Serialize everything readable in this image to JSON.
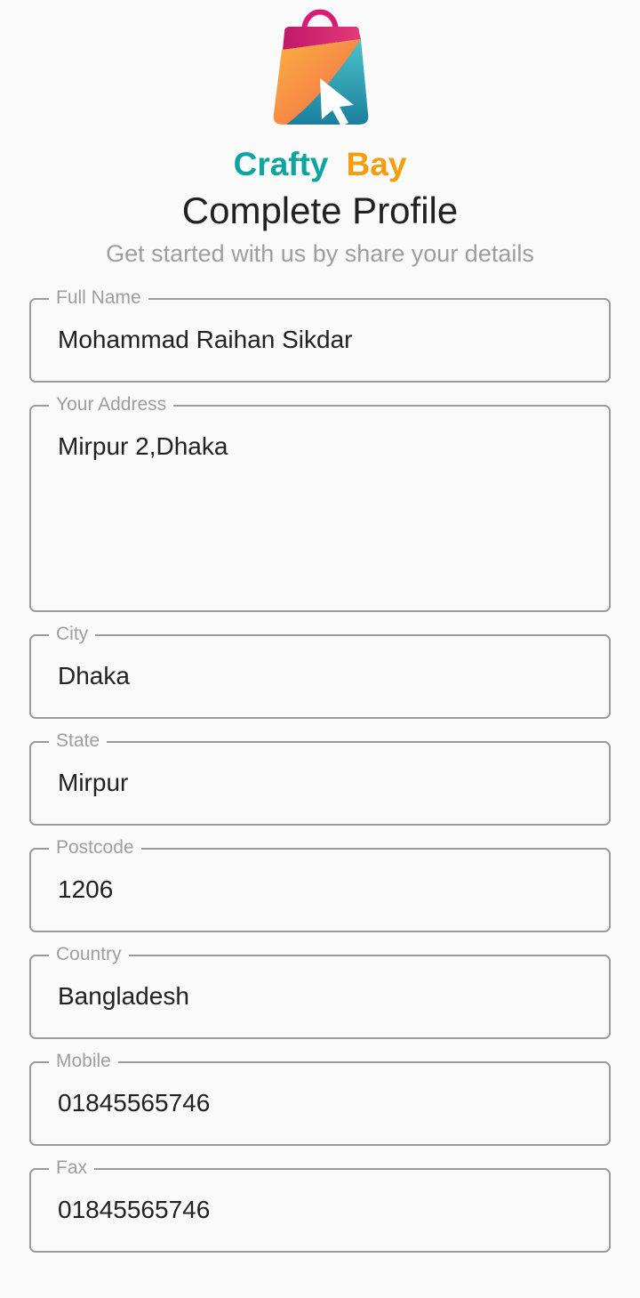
{
  "brand": {
    "word1": "Crafty",
    "word2": "Bay"
  },
  "header": {
    "title": "Complete Profile",
    "subtitle": "Get started with us by share your details"
  },
  "form": {
    "full_name": {
      "label": "Full Name",
      "value": "Mohammad Raihan Sikdar"
    },
    "address": {
      "label": "Your Address",
      "value": "Mirpur 2,Dhaka"
    },
    "city": {
      "label": "City",
      "value": "Dhaka"
    },
    "state": {
      "label": "State",
      "value": "Mirpur"
    },
    "postcode": {
      "label": "Postcode",
      "value": "1206"
    },
    "country": {
      "label": "Country",
      "value": "Bangladesh"
    },
    "mobile": {
      "label": "Mobile",
      "value": "01845565746"
    },
    "fax": {
      "label": "Fax",
      "value": "01845565746"
    }
  },
  "colors": {
    "brand_teal": "#0ea5a0",
    "brand_orange": "#f59e0b",
    "border": "#9b9b9b"
  },
  "icons": {
    "logo": "shopping-bag-cursor-icon"
  }
}
